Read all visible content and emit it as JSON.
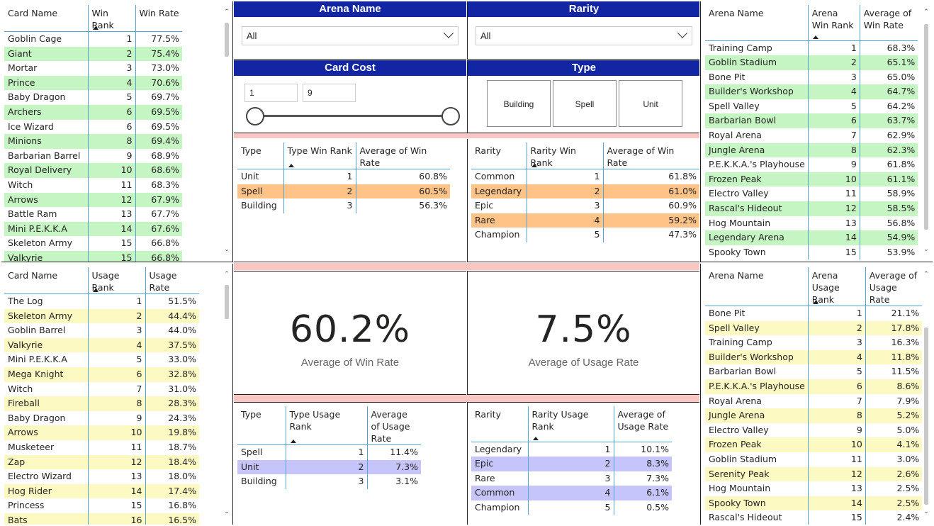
{
  "card_win": {
    "headers": [
      "Card Name",
      "Win Rank",
      "Win Rate"
    ],
    "rows": [
      [
        "Goblin Cage",
        "1",
        "77.5%"
      ],
      [
        "Giant",
        "2",
        "75.4%"
      ],
      [
        "Mortar",
        "3",
        "73.0%"
      ],
      [
        "Prince",
        "4",
        "70.6%"
      ],
      [
        "Baby Dragon",
        "5",
        "69.7%"
      ],
      [
        "Archers",
        "6",
        "69.5%"
      ],
      [
        "Ice Wizard",
        "6",
        "69.5%"
      ],
      [
        "Minions",
        "8",
        "69.4%"
      ],
      [
        "Barbarian Barrel",
        "9",
        "68.9%"
      ],
      [
        "Royal Delivery",
        "10",
        "68.6%"
      ],
      [
        "Witch",
        "11",
        "68.3%"
      ],
      [
        "Arrows",
        "12",
        "67.9%"
      ],
      [
        "Battle Ram",
        "13",
        "67.7%"
      ],
      [
        "Mini P.E.K.K.A",
        "14",
        "67.6%"
      ],
      [
        "Skeleton Army",
        "15",
        "66.8%"
      ],
      [
        "Valkyrie",
        "15",
        "66.8%"
      ]
    ]
  },
  "card_usage": {
    "headers": [
      "Card Name",
      "Usage Rank",
      "Usage Rate"
    ],
    "rows": [
      [
        "The Log",
        "1",
        "51.5%"
      ],
      [
        "Skeleton Army",
        "2",
        "44.4%"
      ],
      [
        "Goblin Barrel",
        "3",
        "44.0%"
      ],
      [
        "Valkyrie",
        "4",
        "37.5%"
      ],
      [
        "Mini P.E.K.K.A",
        "5",
        "33.0%"
      ],
      [
        "Mega Knight",
        "6",
        "32.8%"
      ],
      [
        "Witch",
        "7",
        "31.0%"
      ],
      [
        "Fireball",
        "8",
        "28.3%"
      ],
      [
        "Baby Dragon",
        "9",
        "24.3%"
      ],
      [
        "Arrows",
        "10",
        "19.8%"
      ],
      [
        "Musketeer",
        "11",
        "18.7%"
      ],
      [
        "Zap",
        "12",
        "18.4%"
      ],
      [
        "Electro Wizard",
        "13",
        "18.0%"
      ],
      [
        "Hog Rider",
        "14",
        "17.4%"
      ],
      [
        "Princess",
        "15",
        "16.8%"
      ],
      [
        "Bats",
        "16",
        "16.5%"
      ]
    ]
  },
  "filters": {
    "arena_title": "Arena Name",
    "arena_value": "All",
    "rarity_title": "Rarity",
    "rarity_value": "All",
    "cost_title": "Card Cost",
    "cost_min": "1",
    "cost_max": "9",
    "type_title": "Type",
    "type_buttons": [
      "Building",
      "Spell",
      "Unit"
    ]
  },
  "type_win": {
    "headers": [
      "Type",
      "Type Win Rank",
      "Average of Win Rate"
    ],
    "rows": [
      [
        "Unit",
        "1",
        "60.8%"
      ],
      [
        "Spell",
        "2",
        "60.5%"
      ],
      [
        "Building",
        "3",
        "56.3%"
      ]
    ]
  },
  "rarity_win": {
    "headers": [
      "Rarity",
      "Rarity Win Rank",
      "Average of Win Rate"
    ],
    "rows": [
      [
        "Common",
        "1",
        "61.8%"
      ],
      [
        "Legendary",
        "2",
        "61.0%"
      ],
      [
        "Epic",
        "3",
        "60.9%"
      ],
      [
        "Rare",
        "4",
        "59.2%"
      ],
      [
        "Champion",
        "5",
        "47.3%"
      ]
    ]
  },
  "kpi_win": {
    "value": "60.2%",
    "label": "Average of Win Rate"
  },
  "kpi_usage": {
    "value": "7.5%",
    "label": "Average of Usage Rate"
  },
  "type_usage": {
    "headers": [
      "Type",
      "Type Usage Rank",
      "Average of Usage Rate"
    ],
    "rows": [
      [
        "Spell",
        "1",
        "11.4%"
      ],
      [
        "Unit",
        "2",
        "7.3%"
      ],
      [
        "Building",
        "3",
        "3.1%"
      ]
    ]
  },
  "rarity_usage": {
    "headers": [
      "Rarity",
      "Rarity Usage Rank",
      "Average of Usage Rate"
    ],
    "rows": [
      [
        "Legendary",
        "1",
        "10.1%"
      ],
      [
        "Epic",
        "2",
        "8.3%"
      ],
      [
        "Rare",
        "3",
        "7.3%"
      ],
      [
        "Common",
        "4",
        "6.1%"
      ],
      [
        "Champion",
        "5",
        "0.5%"
      ]
    ]
  },
  "arena_win": {
    "headers": [
      "Arena Name",
      "Arena Win Rank",
      "Average of Win Rate"
    ],
    "rows": [
      [
        "Training Camp",
        "1",
        "68.3%"
      ],
      [
        "Goblin Stadium",
        "2",
        "65.1%"
      ],
      [
        "Bone Pit",
        "3",
        "65.0%"
      ],
      [
        "Builder's Workshop",
        "4",
        "64.7%"
      ],
      [
        "Spell Valley",
        "5",
        "64.2%"
      ],
      [
        "Barbarian Bowl",
        "6",
        "63.7%"
      ],
      [
        "Royal Arena",
        "7",
        "62.9%"
      ],
      [
        "Jungle Arena",
        "8",
        "62.3%"
      ],
      [
        "P.E.K.K.A.'s Playhouse",
        "9",
        "61.8%"
      ],
      [
        "Frozen Peak",
        "10",
        "61.1%"
      ],
      [
        "Electro Valley",
        "11",
        "58.9%"
      ],
      [
        "Rascal's Hideout",
        "12",
        "58.5%"
      ],
      [
        "Hog Mountain",
        "13",
        "56.8%"
      ],
      [
        "Legendary Arena",
        "14",
        "54.9%"
      ],
      [
        "Spooky Town",
        "15",
        "53.9%"
      ]
    ]
  },
  "arena_usage": {
    "headers": [
      "Arena Name",
      "Arena Usage Rank",
      "Average of Usage Rate"
    ],
    "rows": [
      [
        "Bone Pit",
        "1",
        "21.1%"
      ],
      [
        "Spell Valley",
        "2",
        "17.8%"
      ],
      [
        "Training Camp",
        "3",
        "16.3%"
      ],
      [
        "Builder's Workshop",
        "4",
        "11.8%"
      ],
      [
        "Barbarian Bowl",
        "5",
        "11.5%"
      ],
      [
        "P.E.K.K.A.'s Playhouse",
        "6",
        "8.6%"
      ],
      [
        "Royal Arena",
        "7",
        "7.9%"
      ],
      [
        "Jungle Arena",
        "8",
        "5.2%"
      ],
      [
        "Electro Valley",
        "9",
        "5.0%"
      ],
      [
        "Frozen Peak",
        "10",
        "4.1%"
      ],
      [
        "Goblin Stadium",
        "11",
        "3.0%"
      ],
      [
        "Serenity Peak",
        "12",
        "2.6%"
      ],
      [
        "Hog Mountain",
        "13",
        "2.5%"
      ],
      [
        "Spooky Town",
        "14",
        "2.5%"
      ],
      [
        "Rascal's Hideout",
        "15",
        "2.4%"
      ]
    ]
  },
  "scroll_icons": {
    "up": "chevron-up-icon",
    "down": "chevron-down-icon"
  },
  "colors": {
    "title_bar": "#1226a4",
    "divider_pink": "#f9c6c4",
    "green": "#c6f5c4",
    "yellow": "#fdf9c2",
    "orange": "#ffc287",
    "purple": "#c5c4fb",
    "grid_blue": "#4ea7d6"
  }
}
